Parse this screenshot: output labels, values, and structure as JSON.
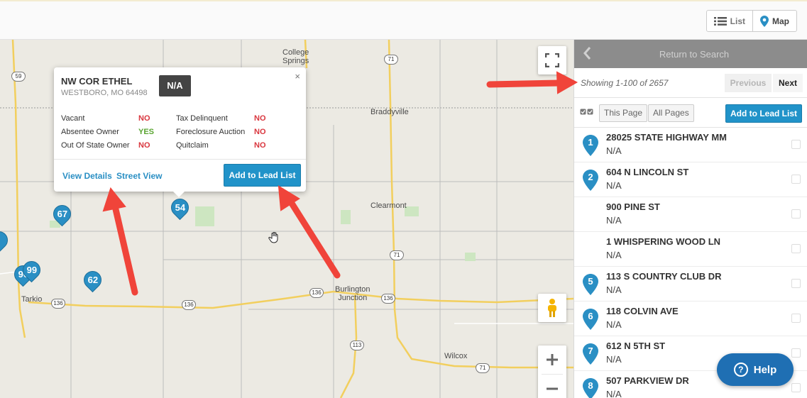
{
  "toolbar": {
    "list_label": "List",
    "map_label": "Map"
  },
  "map": {
    "towns": [
      {
        "id": "college-springs",
        "label": "College\nSprings"
      },
      {
        "id": "braddyville",
        "label": "Braddyville"
      },
      {
        "id": "clearmont",
        "label": "Clearmont"
      },
      {
        "id": "burlington-junction",
        "label": "Burlington\nJunction"
      },
      {
        "id": "tarkio",
        "label": "Tarkio"
      },
      {
        "id": "wilcox",
        "label": "Wilcox"
      }
    ],
    "shields": [
      "59",
      "71",
      "136",
      "136",
      "136",
      "136",
      "71",
      "113",
      "71",
      "59"
    ],
    "pins": [
      "54",
      "67",
      "62",
      "99",
      "96"
    ]
  },
  "popup": {
    "title": "NW COR ETHEL",
    "address": "WESTBORO, MO 64498",
    "badge": "N/A",
    "close": "×",
    "fields": [
      {
        "label": "Vacant",
        "value": "NO"
      },
      {
        "label": "Absentee Owner",
        "value": "YES"
      },
      {
        "label": "Out Of State Owner",
        "value": "NO"
      },
      {
        "label": "Tax Delinquent",
        "value": "NO"
      },
      {
        "label": "Foreclosure Auction",
        "value": "NO"
      },
      {
        "label": "Quitclaim",
        "value": "NO"
      }
    ],
    "view_details": "View Details",
    "street_view": "Street View",
    "add_to_lead_list": "Add to Lead List"
  },
  "panel": {
    "return_label": "Return to Search",
    "showing": "Showing 1-100 of 2657",
    "previous": "Previous",
    "next": "Next",
    "this_page": "This Page",
    "all_pages": "All Pages",
    "add_to_lead_list": "Add to Lead List",
    "results": [
      {
        "num": "1",
        "address": "28025 STATE HIGHWAY MM",
        "sub": "N/A"
      },
      {
        "num": "2",
        "address": "604 N LINCOLN ST",
        "sub": "N/A"
      },
      {
        "num": "",
        "address": "900 PINE ST",
        "sub": "N/A"
      },
      {
        "num": "",
        "address": "1 WHISPERING WOOD LN",
        "sub": "N/A"
      },
      {
        "num": "5",
        "address": "113 S COUNTRY CLUB DR",
        "sub": "N/A"
      },
      {
        "num": "6",
        "address": "118 COLVIN AVE",
        "sub": "N/A"
      },
      {
        "num": "7",
        "address": "612 N 5TH ST",
        "sub": "N/A"
      },
      {
        "num": "8",
        "address": "507 PARKVIEW DR",
        "sub": "N/A"
      }
    ]
  },
  "help": {
    "label": "Help",
    "q": "?"
  },
  "colors": {
    "accent": "#2193c9",
    "pin": "#2a8fc4",
    "no": "#d9363e",
    "yes": "#5aa531",
    "arrow": "#f0443a"
  }
}
